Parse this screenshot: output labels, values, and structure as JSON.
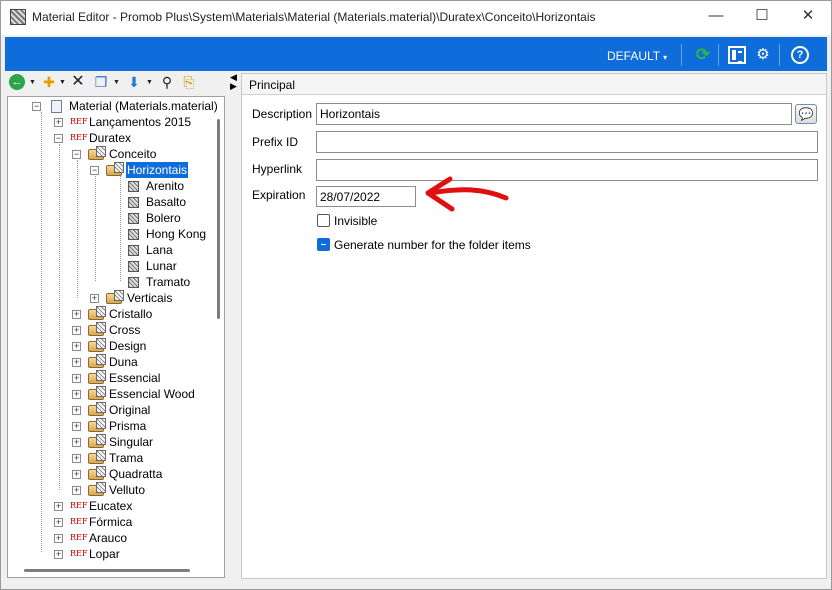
{
  "window": {
    "title": "Material Editor - Promob Plus\\System\\Materials\\Material (Materials.material)\\Duratex\\Conceito\\Horizontais",
    "minimize": "—",
    "maximize": "☐",
    "close": "✕"
  },
  "top_toolbar": {
    "profile_label": "DEFAULT",
    "profile_caret": "▾",
    "accent_color": "#0f6ddb"
  },
  "left_toolbar": {
    "icons": [
      "back-icon",
      "new-folder-icon",
      "delete-icon",
      "copy-icon",
      "move-icon",
      "find-icon",
      "paste-icon"
    ]
  },
  "tree": {
    "root": "Material (Materials.material)",
    "nodes": [
      {
        "label": "Lançamentos 2015",
        "type": "ref"
      },
      {
        "label": "Duratex",
        "type": "ref"
      },
      {
        "label": "Conceito",
        "type": "folder"
      },
      {
        "label": "Horizontais",
        "type": "folder",
        "selected": true
      },
      {
        "label": "Arenito",
        "type": "material"
      },
      {
        "label": "Basalto",
        "type": "material"
      },
      {
        "label": "Bolero",
        "type": "material"
      },
      {
        "label": "Hong Kong",
        "type": "material"
      },
      {
        "label": "Lana",
        "type": "material"
      },
      {
        "label": "Lunar",
        "type": "material"
      },
      {
        "label": "Tramato",
        "type": "material"
      },
      {
        "label": "Verticais",
        "type": "folder"
      },
      {
        "label": "Cristallo",
        "type": "folder"
      },
      {
        "label": "Cross",
        "type": "folder"
      },
      {
        "label": "Design",
        "type": "folder"
      },
      {
        "label": "Duna",
        "type": "folder"
      },
      {
        "label": "Essencial",
        "type": "folder"
      },
      {
        "label": "Essencial Wood",
        "type": "folder"
      },
      {
        "label": "Original",
        "type": "folder"
      },
      {
        "label": "Prisma",
        "type": "folder"
      },
      {
        "label": "Singular",
        "type": "folder"
      },
      {
        "label": "Trama",
        "type": "folder"
      },
      {
        "label": "Quadratta",
        "type": "folder"
      },
      {
        "label": "Velluto",
        "type": "folder"
      },
      {
        "label": "Eucatex",
        "type": "ref"
      },
      {
        "label": "Fórmica",
        "type": "ref"
      },
      {
        "label": "Arauco",
        "type": "ref"
      },
      {
        "label": "Lopar",
        "type": "ref"
      }
    ],
    "ref_badge": "REF"
  },
  "panel": {
    "title": "Principal",
    "description_label": "Description",
    "description_value": "Horizontais",
    "prefix_label": "Prefix ID",
    "prefix_value": "",
    "hyperlink_label": "Hyperlink",
    "hyperlink_value": "",
    "expiration_label": "Expiration",
    "expiration_value": "28/07/2022",
    "invisible_label": "Invisible",
    "generate_label": "Generate number for the folder items"
  },
  "annotation": {
    "arrow_color": "#e01010"
  }
}
